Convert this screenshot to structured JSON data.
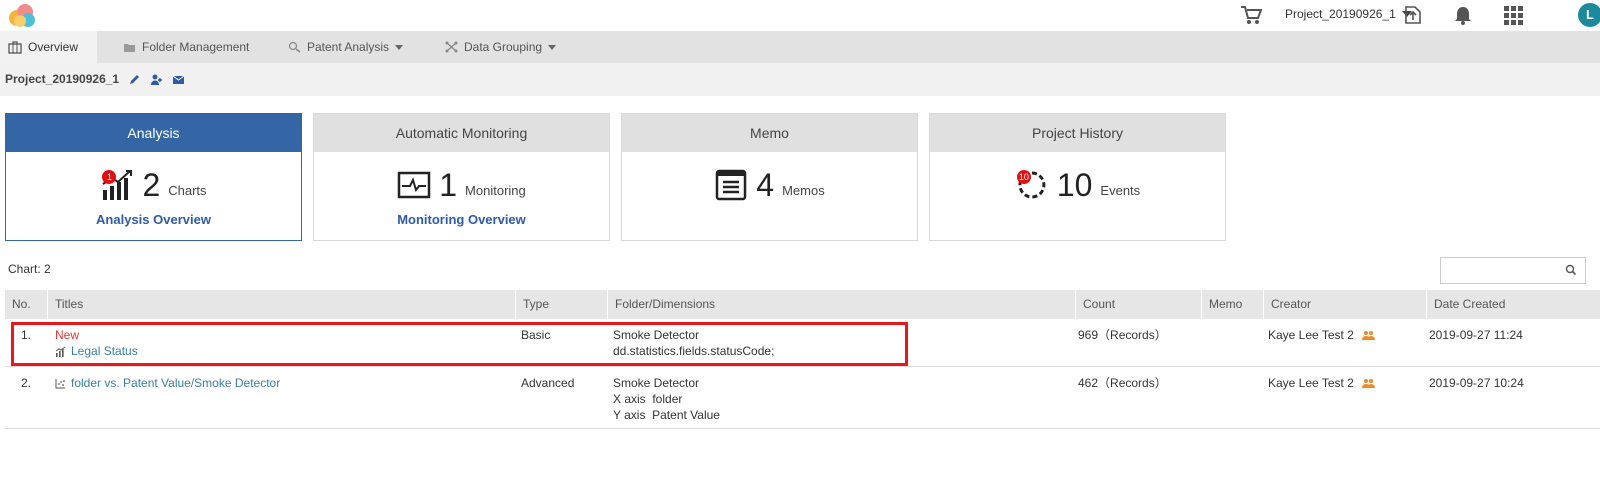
{
  "topbar": {
    "project_selector": "Project_20190926_1",
    "avatar_initial": "L",
    "icons": [
      "cloud-logo-icon",
      "cart-icon",
      "export-icon",
      "bell-icon",
      "apps-grid-icon"
    ]
  },
  "tabs": [
    {
      "label": "Overview",
      "icon": "briefcase-icon",
      "active": true
    },
    {
      "label": "Folder Management",
      "icon": "folder-icon"
    },
    {
      "label": "Patent Analysis",
      "icon": "analysis-icon",
      "dropdown": true
    },
    {
      "label": "Data Grouping",
      "icon": "grouping-icon",
      "dropdown": true
    }
  ],
  "subheader": {
    "project_name": "Project_20190926_1",
    "icons": [
      "edit-icon",
      "add-user-icon",
      "mail-icon"
    ]
  },
  "cards": [
    {
      "title": "Analysis",
      "count": "2",
      "unit": "Charts",
      "badge": "1",
      "link": "Analysis Overview",
      "active": true
    },
    {
      "title": "Automatic Monitoring",
      "count": "1",
      "unit": "Monitoring",
      "link": "Monitoring Overview"
    },
    {
      "title": "Memo",
      "count": "4",
      "unit": "Memos"
    },
    {
      "title": "Project History",
      "count": "10",
      "unit": "Events",
      "badge": "10"
    }
  ],
  "list": {
    "chart_count": "Chart: 2",
    "search_placeholder": "",
    "columns": [
      "No.",
      "Titles",
      "Type",
      "Folder/Dimensions",
      "Count",
      "Memo",
      "Creator",
      "Date Created"
    ],
    "rows": [
      {
        "no": "1.",
        "new_label": "New",
        "title": "Legal Status",
        "type": "Basic",
        "folder": "Smoke Detector",
        "dim1": "dd.statistics.fields.statusCode;",
        "count": "969（Records）",
        "memo": "",
        "creator": "Kaye Lee Test 2",
        "date": "2019-09-27 11:24"
      },
      {
        "no": "2.",
        "title": "folder vs. Patent Value/Smoke Detector",
        "type": "Advanced",
        "folder": "Smoke Detector",
        "dim1": "X axis  folder",
        "dim2": "Y axis  Patent Value",
        "count": "462（Records）",
        "memo": "",
        "creator": "Kaye Lee Test 2",
        "date": "2019-09-27 10:24"
      }
    ]
  },
  "colors": {
    "accent": "#3465a4",
    "link": "#2e5aa8",
    "title_link": "#3a7fa3",
    "new": "#e33333",
    "highlight": "#e8191c",
    "avatar": "#1a8a9c"
  }
}
